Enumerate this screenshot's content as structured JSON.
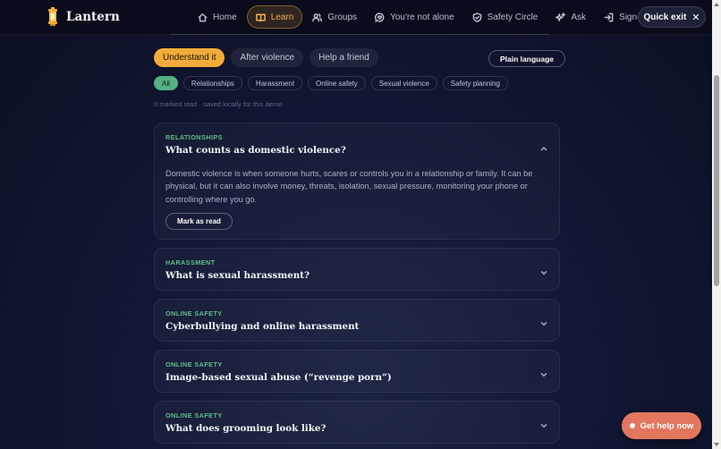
{
  "app": {
    "name": "Lantern"
  },
  "nav": {
    "items": [
      {
        "label": "Home",
        "icon": "home-icon",
        "active": false
      },
      {
        "label": "Learn",
        "icon": "book-icon",
        "active": true
      },
      {
        "label": "Groups",
        "icon": "users-icon",
        "active": false
      },
      {
        "label": "You're not alone",
        "icon": "chat-heart-icon",
        "active": false
      },
      {
        "label": "Safety Circle",
        "icon": "shield-icon",
        "active": false
      },
      {
        "label": "Ask",
        "icon": "sparkle-icon",
        "active": false
      },
      {
        "label": "Sign-in co",
        "icon": "sign-in-icon",
        "active": false
      }
    ],
    "quick_exit": "Quick exit",
    "quick_exit_icon": "close-icon"
  },
  "modes": {
    "tabs": [
      "Understand it",
      "After violence",
      "Help a friend"
    ],
    "active": "Understand it",
    "plain_language": "Plain language"
  },
  "filters": {
    "chips": [
      "All",
      "Relationships",
      "Harassment",
      "Online safety",
      "Sexual violence",
      "Safety planning"
    ],
    "active": "All"
  },
  "read_status": "0 marked read · saved locally for this demo",
  "articles": [
    {
      "category": "RELATIONSHIPS",
      "title": "What counts as domestic violence?",
      "expanded": true,
      "body": "Domestic violence is when someone hurts, scares or controls you in a relationship or family. It can be physical, but it can also involve money, threats, isolation, sexual pressure, monitoring your phone or controlling where you go.",
      "action": "Mark as read"
    },
    {
      "category": "HARASSMENT",
      "title": "What is sexual harassment?",
      "expanded": false
    },
    {
      "category": "ONLINE SAFETY",
      "title": "Cyberbullying and online harassment",
      "expanded": false
    },
    {
      "category": "ONLINE SAFETY",
      "title": "Image-based sexual abuse (“revenge porn”)",
      "expanded": false
    },
    {
      "category": "ONLINE SAFETY",
      "title": "What does grooming look like?",
      "expanded": false
    }
  ],
  "get_help": {
    "label": "Get help now"
  },
  "colors": {
    "accent": "#f2ab3b",
    "category": "#5fbf8b",
    "chip_active": "#54b182",
    "help_button": "#e3765f",
    "background": "#121734"
  }
}
